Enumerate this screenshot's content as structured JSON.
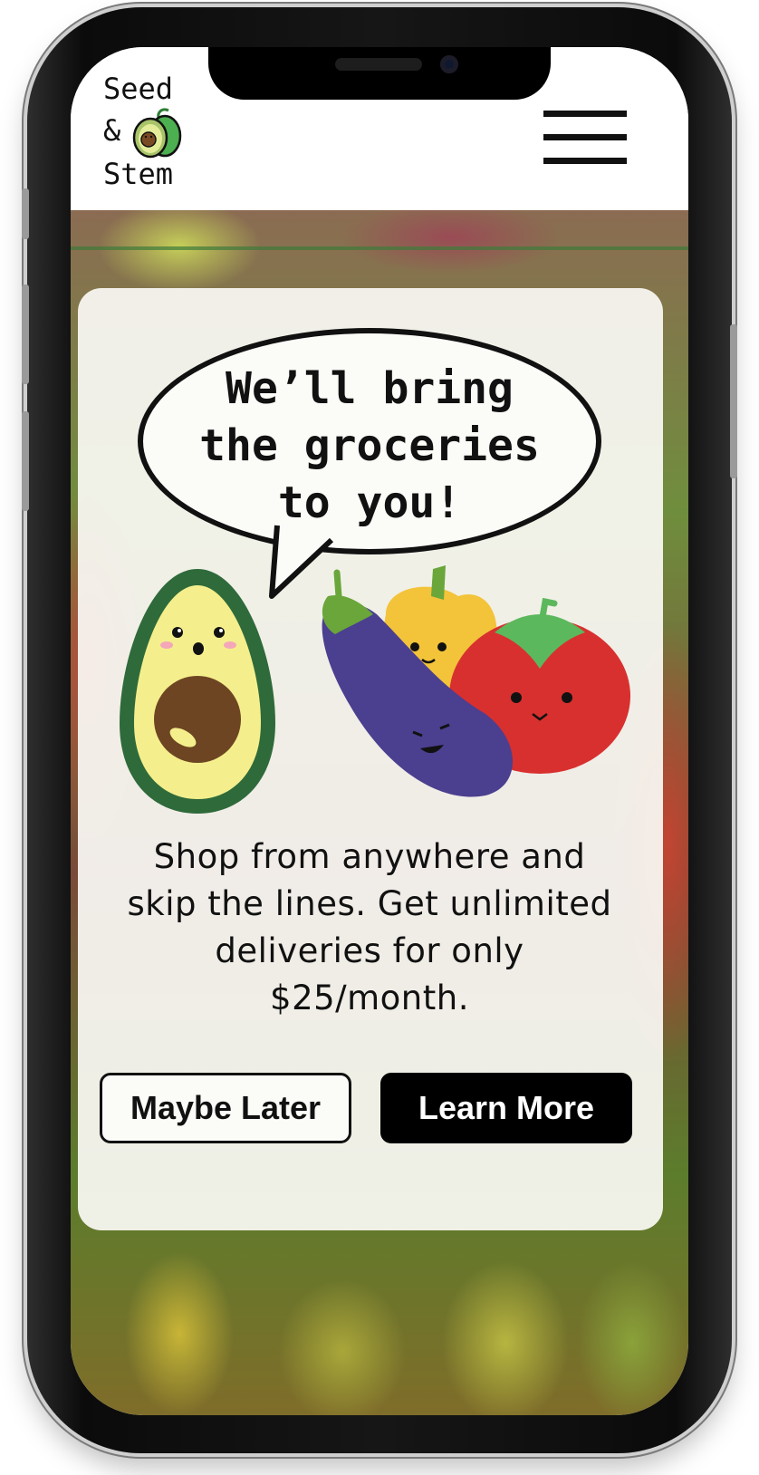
{
  "brand": {
    "line1": "Seed",
    "line2": "&",
    "line3": "Stem",
    "logo_icon": "avocado-icon"
  },
  "header": {
    "menu_icon": "hamburger-menu-icon"
  },
  "hero": {
    "headline_line1": "We’ll bring",
    "headline_line2": "the groceries",
    "headline_line3": "to you!",
    "tagline_line1": "Shop from anywhere and",
    "tagline_line2": "skip the lines. Get unlimited",
    "tagline_line3": "deliveries for only",
    "tagline_line4": "$25/month.",
    "illustration_icons": [
      "avocado-icon",
      "eggplant-icon",
      "pepper-icon",
      "tomato-icon"
    ]
  },
  "actions": {
    "maybe_later_label": "Maybe Later",
    "learn_more_label": "Learn More"
  },
  "colors": {
    "accent": "#000000",
    "avocado_green": "#2f6a3a",
    "avocado_flesh": "#f4ef8c",
    "eggplant": "#4b3f8f",
    "tomato": "#d8302f",
    "pepper": "#f3c33a"
  }
}
